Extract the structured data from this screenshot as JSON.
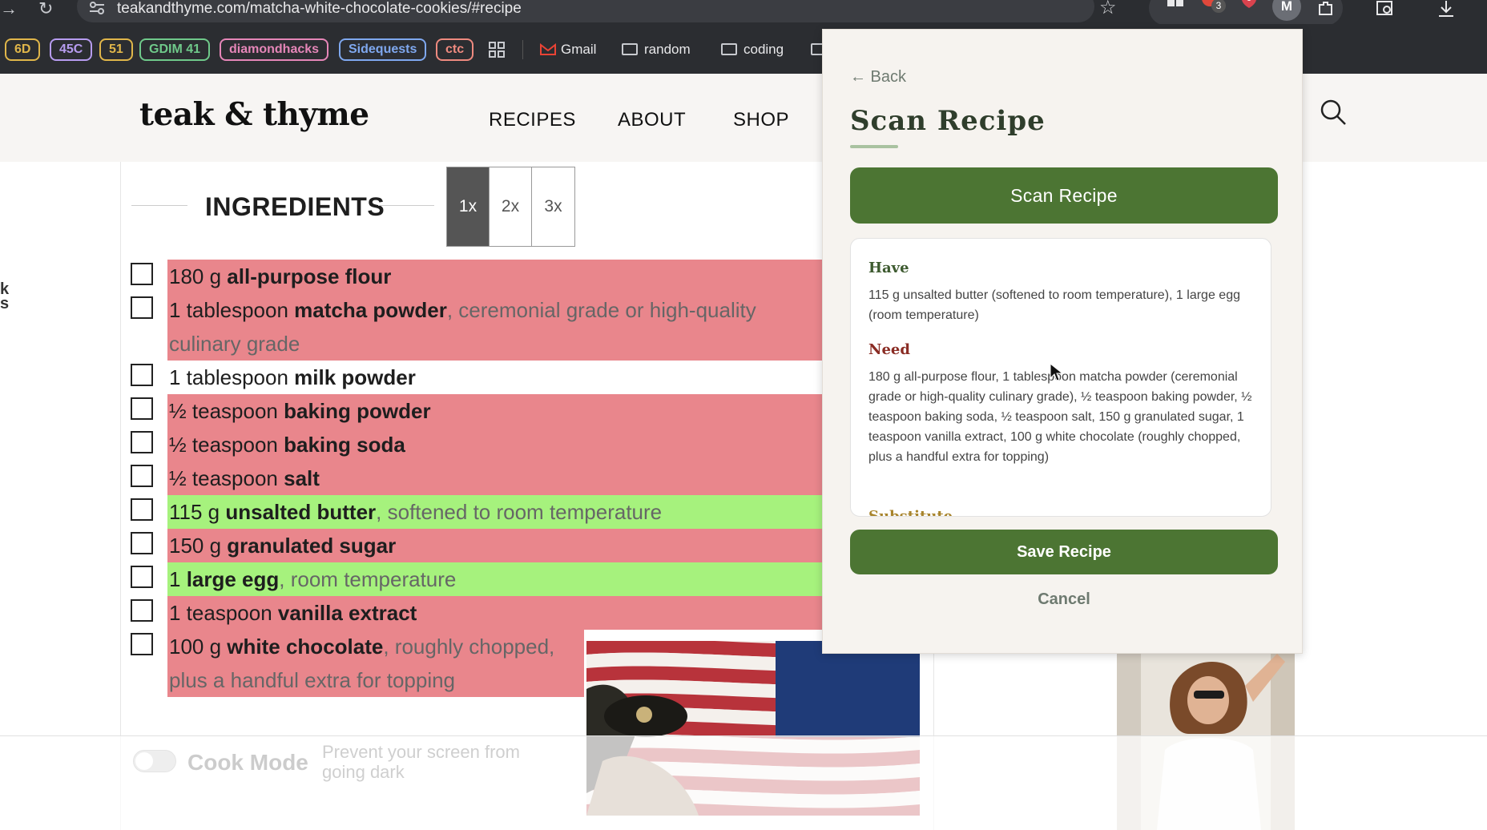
{
  "browser": {
    "url": "teakandthyme.com/matcha-white-chocolate-cookies/#recipe",
    "back_glyph": "→",
    "reload_glyph": "↻",
    "star_glyph": "☆",
    "profile_initial": "M",
    "extension_badge": "3",
    "bookmarks": [
      {
        "label": "6D",
        "color": "#e0b64a"
      },
      {
        "label": "45C",
        "color": "#b79cf0"
      },
      {
        "label": "51",
        "color": "#e0b64a"
      },
      {
        "label": "GDIM 41",
        "color": "#6fc98a"
      },
      {
        "label": "diamondhacks",
        "color": "#e586b8"
      },
      {
        "label": "Sidequests",
        "color": "#7fa8ef"
      },
      {
        "label": "ctc",
        "color": "#ef8a7f"
      }
    ],
    "bookmark_links": {
      "gmail": "Gmail",
      "random": "random",
      "coding": "coding"
    }
  },
  "site": {
    "logo": "teak & thyme",
    "nav": {
      "recipes": "RECIPES",
      "about": "ABOUT",
      "shop": "SHOP"
    }
  },
  "ingredients": {
    "heading": "INGREDIENTS",
    "scale_options": [
      "1x",
      "2x",
      "3x"
    ],
    "selected_scale": "1x",
    "items": [
      {
        "qty": "180 g ",
        "name": "all-purpose flour",
        "note": "",
        "status": "need"
      },
      {
        "qty": "1 tablespoon ",
        "name": "matcha powder",
        "note": ", ceremonial grade or high-quality culinary grade",
        "status": "need"
      },
      {
        "qty": "1 tablespoon ",
        "name": "milk powder",
        "note": "",
        "status": "none"
      },
      {
        "qty": "½ teaspoon ",
        "name": "baking powder",
        "note": "",
        "status": "need"
      },
      {
        "qty": "½ teaspoon ",
        "name": "baking soda",
        "note": "",
        "status": "need"
      },
      {
        "qty": "½ teaspoon ",
        "name": "salt",
        "note": "",
        "status": "need"
      },
      {
        "qty": "115 g ",
        "name": "unsalted butter",
        "note": ", softened to room temperature",
        "status": "have"
      },
      {
        "qty": "150 g ",
        "name": "granulated sugar",
        "note": "",
        "status": "need"
      },
      {
        "qty": "1 ",
        "name": "large egg",
        "note": ", room temperature",
        "status": "have"
      },
      {
        "qty": "1 teaspoon ",
        "name": "vanilla extract",
        "note": "",
        "status": "need"
      },
      {
        "qty": "100 g ",
        "name": "white chocolate",
        "note": ", roughly chopped, plus a handful extra for topping",
        "status": "need"
      }
    ],
    "cook_mode": {
      "label": "Cook Mode",
      "description": "Prevent your screen from going dark"
    },
    "edge_text": "k\ns"
  },
  "panel": {
    "back": "← Back",
    "title": "Scan Recipe",
    "scan_button": "Scan Recipe",
    "have_heading": "Have",
    "have_text": "115 g unsalted butter (softened to room temperature), 1 large egg (room temperature)",
    "need_heading": "Need",
    "need_text": "180 g all-purpose flour, 1 tablespoon matcha powder (ceremonial grade or high-quality culinary grade), ½ teaspoon baking powder, ½ teaspoon baking soda, ½ teaspoon salt, 150 g granulated sugar, 1 teaspoon vanilla extract, 100 g white chocolate (roughly chopped, plus a handful extra for topping)",
    "substitute_heading": "Substitute",
    "save_button": "Save Recipe",
    "cancel_button": "Cancel"
  },
  "colors": {
    "need_highlight": "#e9868c",
    "have_highlight": "#a6f27d",
    "accent_green": "#4c7533"
  }
}
